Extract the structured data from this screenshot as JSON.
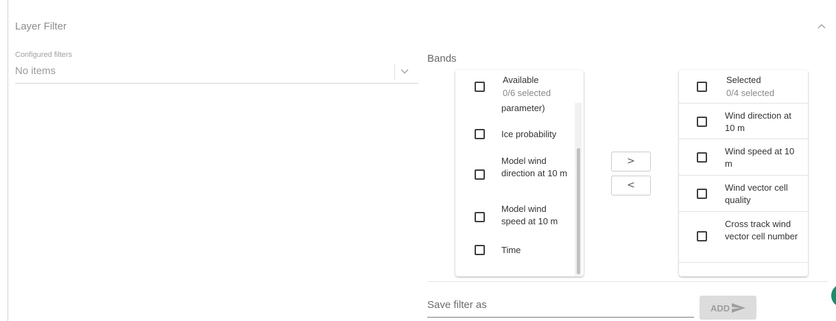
{
  "panel": {
    "title": "Layer Filter"
  },
  "configured": {
    "label": "Configured filters",
    "value": "No items"
  },
  "bands": {
    "label": "Bands",
    "available": {
      "title": "Available",
      "count": "0/6 selected",
      "items": [
        {
          "label": "parameter)"
        },
        {
          "label": "Ice probability"
        },
        {
          "label": "Model wind direction at 10 m"
        },
        {
          "label": "Model wind speed at 10 m"
        },
        {
          "label": "Time"
        }
      ]
    },
    "selected": {
      "title": "Selected",
      "count": "0/4 selected",
      "items": [
        {
          "label": "Wind direction at 10 m"
        },
        {
          "label": "Wind speed at 10 m"
        },
        {
          "label": "Wind vector cell quality"
        },
        {
          "label": "Cross track wind vector cell number"
        }
      ]
    },
    "move_right_label": ">",
    "move_left_label": "<"
  },
  "save": {
    "placeholder": "Save filter as",
    "add_label": "ADD"
  },
  "colors": {
    "accent": "#1f8a6e",
    "disabled_button": "#dcdcdc"
  }
}
